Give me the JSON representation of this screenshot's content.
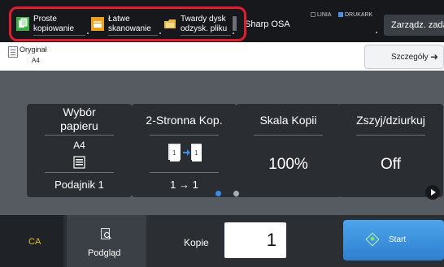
{
  "top_bar": {
    "shortcuts": [
      {
        "line1": "Proste",
        "line2": "kopiowanie",
        "icon": "copy-icon",
        "color": "#3fae49"
      },
      {
        "line1": "Łatwe",
        "line2": "skanowanie",
        "icon": "scan-icon",
        "color": "#f0a020"
      },
      {
        "line1": "Twardy dysk",
        "line2": "odzysk. pliku",
        "icon": "folder-icon",
        "color": "#e8b84a"
      }
    ],
    "device_name": "Sharp OSA",
    "status_line": "LINIA",
    "status_printer": "DRUKARK",
    "manage_button": "Zarządz. zadani",
    "highlight_color": "#e01d2e"
  },
  "original": {
    "label": "Oryginał",
    "value": "A4",
    "details_button": "Szczegóły"
  },
  "tiles": [
    {
      "title_line1": "Wybór",
      "title_line2": "papieru",
      "value": "A4",
      "icon": "paper-tray-icon",
      "footer": "Podajnik 1"
    },
    {
      "title": "2-Stronna Kop.",
      "icon": "duplex-icon",
      "footer": "1 → 1"
    },
    {
      "title": "Skala Kopii",
      "value": "100%"
    },
    {
      "title": "Zszyj/dziurkuj",
      "value": "Off"
    }
  ],
  "pager": {
    "active_page": 1,
    "total_pages": 2,
    "active_color": "#3a8ee6"
  },
  "bottom_bar": {
    "ca_label": "CA",
    "preview_label": "Podgląd",
    "copies_label": "Kopie",
    "copies_value": "1",
    "start_label": "Start"
  }
}
